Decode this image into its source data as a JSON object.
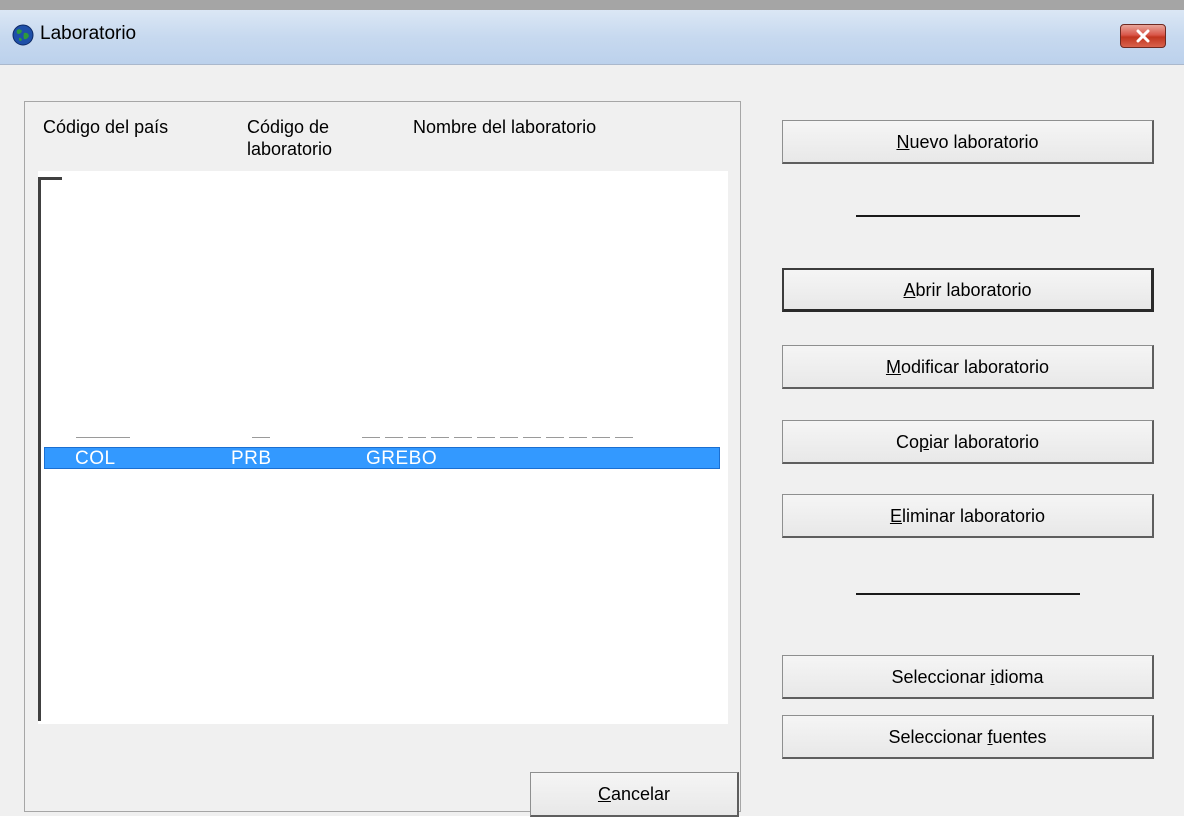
{
  "window": {
    "title": "Laboratorio",
    "icon": "globe-icon",
    "close_icon": "close-icon",
    "close_color": "#d9574a"
  },
  "list": {
    "columns": [
      "Código del país",
      "Código de",
      "laboratorio",
      "Nombre del laboratorio"
    ],
    "selected_row": {
      "country_code": "COL",
      "lab_code": "PRB",
      "lab_name": "GREBO"
    },
    "selection_color": "#3399ff"
  },
  "buttons": {
    "new_lab": {
      "accel": "N",
      "rest": "uevo laboratorio"
    },
    "open_lab": {
      "accel": "A",
      "rest": "brir laboratorio"
    },
    "modify_lab": {
      "accel": "M",
      "rest": "odificar laboratorio"
    },
    "copy_lab": {
      "pre": "Co",
      "accel": "p",
      "rest": "iar laboratorio"
    },
    "delete_lab": {
      "accel": "E",
      "rest": "liminar laboratorio"
    },
    "select_language": {
      "pre": "Seleccionar ",
      "accel": "i",
      "rest": "dioma"
    },
    "select_fonts": {
      "pre": "Seleccionar ",
      "accel": "f",
      "rest": "uentes"
    },
    "cancel": {
      "accel": "C",
      "rest": "ancelar"
    }
  }
}
